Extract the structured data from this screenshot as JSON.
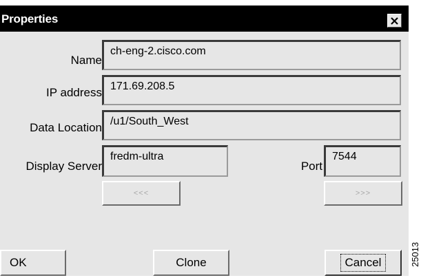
{
  "window": {
    "title": "Properties",
    "close_icon": "close-icon"
  },
  "fields": {
    "name": {
      "label": "Name",
      "value": "ch-eng-2.cisco.com"
    },
    "ip_address": {
      "label": "IP address",
      "value": "171.69.208.5"
    },
    "data_location": {
      "label": "Data Location",
      "value": "/u1/South_West"
    },
    "display_server": {
      "label": "Display Server",
      "value": "fredm-ultra"
    },
    "port": {
      "label": "Port",
      "value": "7544"
    }
  },
  "nav_buttons": {
    "prev_label": "<<<",
    "next_label": ">>>"
  },
  "actions": {
    "ok_label": "OK",
    "clone_label": "Clone",
    "cancel_label": "Cancel"
  },
  "figure_code": "25013",
  "colors": {
    "dialog_bg": "#e6e6e6",
    "titlebar_bg": "#000000",
    "disabled_text": "#a8a8a8"
  }
}
